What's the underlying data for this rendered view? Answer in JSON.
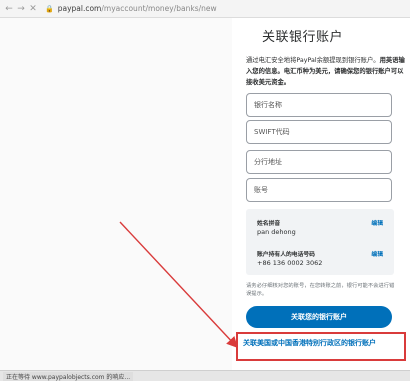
{
  "browser": {
    "url_host": "paypal.com",
    "url_path": "/myaccount/money/banks/new",
    "status": "正在等待 www.paypalobjects.com 的响应..."
  },
  "page": {
    "title": "关联银行账户",
    "desc_normal": "通过电汇安全地将PayPal余额提现到银行账户。",
    "desc_bold": "用英语输入您的信息。电汇币种为美元，请确保您的银行账户可以接收美元资金。"
  },
  "form": {
    "bank_name_placeholder": "银行名称",
    "swift_placeholder": "SWIFT代码",
    "branch_placeholder": "分行地址",
    "account_placeholder": "账号"
  },
  "info": {
    "name_label": "姓名拼音",
    "name_value": "pan dehong",
    "phone_label": "账户持有人的电话号码",
    "phone_value": "+86 136 0002 3062",
    "edit_label": "编辑"
  },
  "note": "请务必仔细核对您的账号，在您转账之前，银行可能不会进行错误提示。",
  "buttons": {
    "link_bank": "关联您的银行账户",
    "hk_link": "关联美国或中国香港特别行政区的银行账户"
  },
  "colors": {
    "primary": "#0070ba",
    "annotation": "#d93b3b"
  }
}
